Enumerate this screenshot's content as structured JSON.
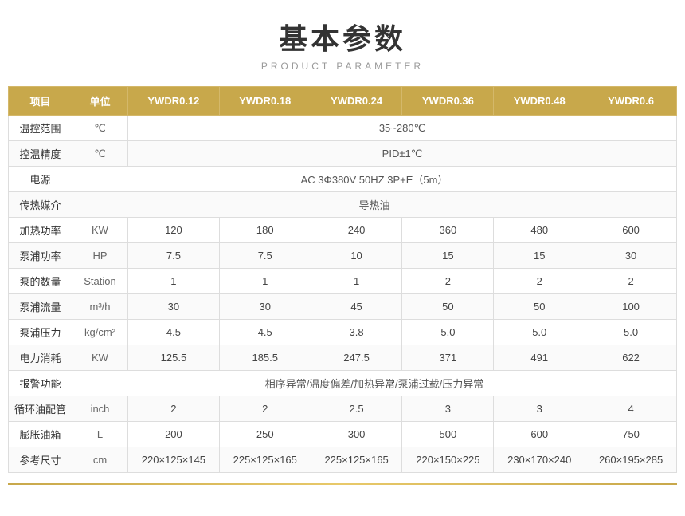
{
  "title": "基本参数",
  "subtitle": "PRODUCT PARAMETER",
  "table": {
    "headers": [
      "项目",
      "单位",
      "YWDR0.12",
      "YWDR0.18",
      "YWDR0.24",
      "YWDR0.36",
      "YWDR0.48",
      "YWDR0.6"
    ],
    "rows": [
      {
        "label": "温控范围",
        "unit": "℃",
        "spanValue": "35~280℃",
        "span": true
      },
      {
        "label": "控温精度",
        "unit": "℃",
        "spanValue": "PID±1℃",
        "span": true
      },
      {
        "label": "电源",
        "unit": "",
        "spanValue": "AC 3Φ380V 50HZ 3P+E（5m）",
        "span": true,
        "spanAll": true
      },
      {
        "label": "传热媒介",
        "unit": "",
        "spanValue": "导热油",
        "span": true,
        "spanAll": true
      },
      {
        "label": "加热功率",
        "unit": "KW",
        "values": [
          "120",
          "180",
          "240",
          "360",
          "480",
          "600"
        ],
        "span": false
      },
      {
        "label": "泵浦功率",
        "unit": "HP",
        "values": [
          "7.5",
          "7.5",
          "10",
          "15",
          "15",
          "30"
        ],
        "span": false
      },
      {
        "label": "泵的数量",
        "unit": "Station",
        "values": [
          "1",
          "1",
          "1",
          "2",
          "2",
          "2"
        ],
        "span": false
      },
      {
        "label": "泵浦流量",
        "unit": "m³/h",
        "values": [
          "30",
          "30",
          "45",
          "50",
          "50",
          "100"
        ],
        "span": false
      },
      {
        "label": "泵浦压力",
        "unit": "kg/cm²",
        "values": [
          "4.5",
          "4.5",
          "3.8",
          "5.0",
          "5.0",
          "5.0"
        ],
        "span": false
      },
      {
        "label": "电力消耗",
        "unit": "KW",
        "values": [
          "125.5",
          "185.5",
          "247.5",
          "371",
          "491",
          "622"
        ],
        "span": false
      },
      {
        "label": "报警功能",
        "unit": "",
        "spanValue": "相序异常/温度偏差/加热异常/泵浦过载/压力异常",
        "span": true,
        "spanAll": true
      },
      {
        "label": "循环油配管",
        "unit": "inch",
        "values": [
          "2",
          "2",
          "2.5",
          "3",
          "3",
          "4"
        ],
        "span": false
      },
      {
        "label": "膨胀油箱",
        "unit": "L",
        "values": [
          "200",
          "250",
          "300",
          "500",
          "600",
          "750"
        ],
        "span": false
      },
      {
        "label": "参考尺寸",
        "unit": "cm",
        "values": [
          "220×125×145",
          "225×125×165",
          "225×125×165",
          "220×150×225",
          "230×170×240",
          "260×195×285"
        ],
        "span": false
      }
    ]
  },
  "colors": {
    "headerBg": "#c8a84b",
    "accent": "#c8a84b"
  }
}
